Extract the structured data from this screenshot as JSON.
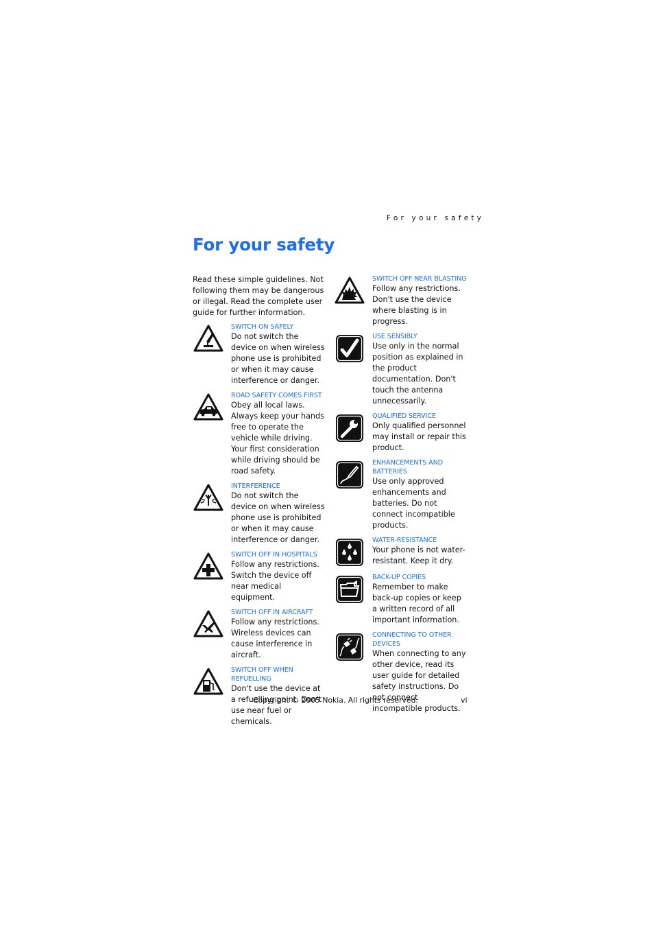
{
  "running_head": "For your safety",
  "title": "For your safety",
  "intro": "Read these simple guidelines. Not following them may be dangerous or illegal. Read the complete user guide for further information.",
  "colors": {
    "accent": "#1e6fe6",
    "text": "#111111"
  },
  "left_items": [
    {
      "icon": "switch-on-safely-icon",
      "heading": "SWITCH ON SAFELY",
      "body": "Do not switch the device on when wireless phone use is prohibited or when it may cause interference or danger."
    },
    {
      "icon": "car-icon",
      "heading": "ROAD SAFETY COMES FIRST",
      "body": "Obey all local laws. Always keep your hands free to operate the vehicle while driving. Your first consideration while driving should be road safety."
    },
    {
      "icon": "interference-icon",
      "heading": "INTERFERENCE",
      "body": "Do not switch the device on when wireless phone use is prohibited or when it may cause interference or danger."
    },
    {
      "icon": "hospital-cross-icon",
      "heading": "SWITCH OFF IN HOSPITALS",
      "body": "Follow any restrictions. Switch the device off near medical equipment."
    },
    {
      "icon": "aircraft-icon",
      "heading": "SWITCH OFF IN AIRCRAFT",
      "body": "Follow any restrictions. Wireless devices can cause interference in aircraft."
    },
    {
      "icon": "fuel-pump-icon",
      "heading": "SWITCH OFF WHEN REFUELLING",
      "body": "Don't use the device at a refuelling point. Don't use near fuel or chemicals."
    }
  ],
  "right_items": [
    {
      "icon": "explosion-icon",
      "heading": "SWITCH OFF NEAR BLASTING",
      "body": "Follow any restrictions. Don't use the device where blasting is in progress."
    },
    {
      "icon": "checkmark-icon",
      "heading": "USE SENSIBLY",
      "body": "Use only in the normal position as explained in the product documentation. Don't touch the antenna unnecessarily."
    },
    {
      "icon": "wrench-icon",
      "heading": "QUALIFIED SERVICE",
      "body": "Only qualified personnel may install or repair this product."
    },
    {
      "icon": "cable-icon",
      "heading": "ENHANCEMENTS AND BATTERIES",
      "body": "Use only approved enhancements and batteries. Do not connect incompatible products."
    },
    {
      "icon": "water-drops-icon",
      "heading": "WATER-RESISTANCE",
      "body": "Your phone is not water-resistant. Keep it dry."
    },
    {
      "icon": "folder-icon",
      "heading": "BACK-UP COPIES",
      "body": "Remember to make back-up copies or keep a written record of all important information."
    },
    {
      "icon": "plugs-icon",
      "heading": "CONNECTING TO OTHER DEVICES",
      "body": "When connecting to any other device, read its user guide for detailed safety instructions. Do not connect incompatible products."
    }
  ],
  "footer": {
    "copyright": "Copyright © 2005 Nokia. All rights reserved.",
    "page_number": "vi"
  }
}
